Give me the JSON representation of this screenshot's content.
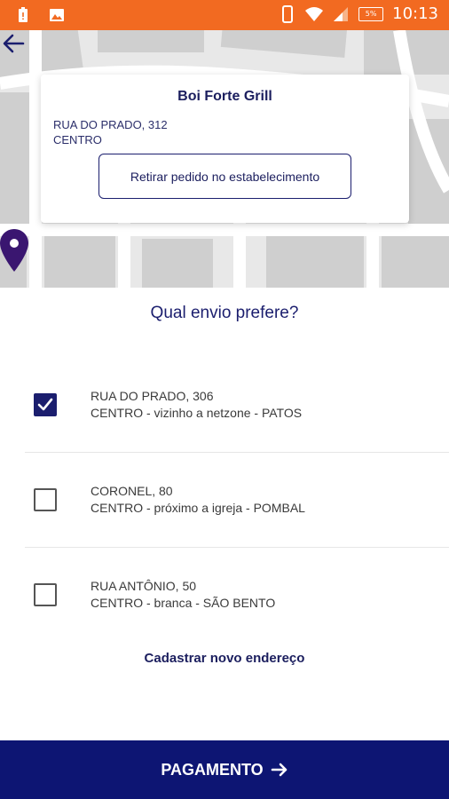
{
  "status_bar": {
    "time": "10:13",
    "battery_text": "5%",
    "colors": {
      "background": "#f26a21"
    },
    "icons": [
      "battery-alert-icon",
      "image-icon",
      "phone-icon",
      "wifi-icon",
      "signal-icon",
      "battery-icon"
    ]
  },
  "store": {
    "name": "Boi Forte Grill",
    "address_line1": "RUA DO PRADO, 312",
    "address_line2": "CENTRO",
    "pickup_label": "Retirar pedido no estabelecimento"
  },
  "question": "Qual envio prefere?",
  "addresses": [
    {
      "line1": "RUA DO PRADO, 306",
      "line2": "CENTRO - vizinho a netzone - PATOS",
      "checked": true
    },
    {
      "line1": "CORONEL, 80",
      "line2": "CENTRO - próximo a igreja - POMBAL",
      "checked": false
    },
    {
      "line1": "RUA ANTÔNIO, 50",
      "line2": "CENTRO - branca - SÃO BENTO",
      "checked": false
    }
  ],
  "new_address_label": "Cadastrar novo endereço",
  "payment": {
    "label": "PAGAMENTO",
    "icon": "arrow-right-icon"
  },
  "colors": {
    "primary": "#0d1573",
    "text_dark_blue": "#1b1e5e",
    "pin": "#3a1670"
  }
}
